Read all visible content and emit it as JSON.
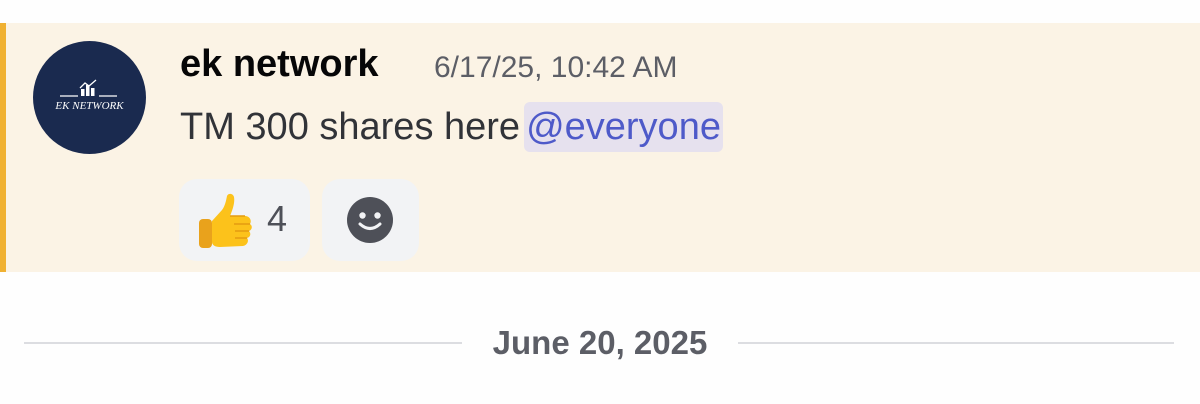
{
  "message": {
    "author": "ek network",
    "timestamp": "6/17/25, 10:42 AM",
    "text": "TM 300 shares here",
    "mention": "@everyone",
    "avatar": {
      "logo_text": "EK NETWORK",
      "background": "#1a2a4f"
    },
    "highlight_color": "#f0b132",
    "reactions": [
      {
        "emoji": "thumbs-up",
        "count": "4"
      }
    ],
    "add_reaction_icon": "smiley-face-icon"
  },
  "date_divider": {
    "label": "June 20, 2025"
  }
}
